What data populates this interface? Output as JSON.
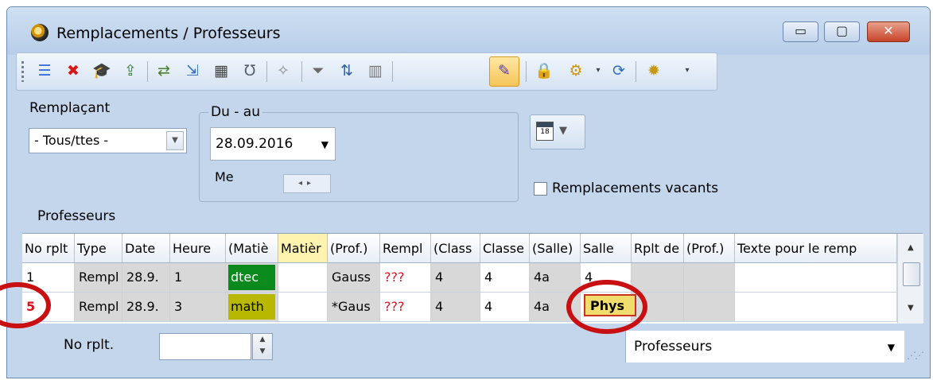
{
  "window": {
    "title": "Remplacements / Professeurs",
    "buttons": {
      "minimize": "▭",
      "maximize": "▢",
      "close": "✕"
    }
  },
  "toolbar": {
    "icons": [
      "list-icon",
      "delete-icon",
      "graduation-cap-icon",
      "export-icon",
      "swap-icon",
      "import-icon",
      "calculator-icon",
      "stethoscope-icon",
      "wand-icon",
      "filter-icon",
      "sort-icon",
      "columns-icon",
      "paint-icon",
      "lock-icon",
      "settings-icon",
      "refresh-icon",
      "gear-icon"
    ]
  },
  "filters": {
    "remplacant_label": "Remplaçant",
    "remplacant_value": "- Tous/ttes -",
    "du_au_label": "Du - au",
    "date_value": "28.09.2016",
    "day_label": "Me",
    "calendar_number": "18",
    "vacants_label": "Remplacements vacants",
    "vacants_checked": false,
    "section_label": "Professeurs"
  },
  "grid": {
    "columns": [
      "No rplt",
      "Type",
      "Date",
      "Heure",
      "(Matiè",
      "Matièr",
      "(Prof.)",
      "Rempl",
      "(Class",
      "Classe",
      "(Salle)",
      "Salle",
      "Rplt de",
      "(Prof.)",
      "Texte pour le remp"
    ],
    "rows": [
      {
        "no": "1",
        "type": "Rempl",
        "date": "28.9.",
        "heure": "1",
        "matiere_orig": "dtec",
        "matiere": "",
        "prof_orig": "Gauss",
        "rempl": "???",
        "classe_orig": "4",
        "classe": "4",
        "salle_orig": "4a",
        "salle": "4",
        "rplt_de": "",
        "prof2": "",
        "texte": ""
      },
      {
        "no": "5",
        "type": "Rempl",
        "date": "28.9.",
        "heure": "3",
        "matiere_orig": "math",
        "matiere": "",
        "prof_orig": "*Gaus",
        "rempl": "???",
        "classe_orig": "4",
        "classe": "4",
        "salle_orig": "4a",
        "salle": "Phys",
        "rplt_de": "",
        "prof2": "",
        "texte": ""
      }
    ],
    "subject_colors": {
      "dtec": "#0a8a1c",
      "math": "#b8b800",
      "matiere_header": "#fff3b0",
      "no_highlight": "#e0101c"
    }
  },
  "statusbar": {
    "no_rplt_label": "No rplt.",
    "no_rplt_value": "",
    "view_value": "Professeurs"
  }
}
